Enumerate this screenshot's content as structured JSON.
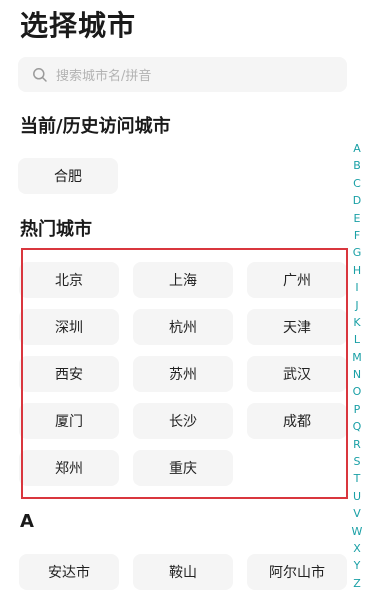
{
  "header": {
    "title": "选择城市"
  },
  "search": {
    "placeholder": "搜索城市名/拼音"
  },
  "current_section": {
    "title": "当前/历史访问城市",
    "cities": [
      "合肥"
    ]
  },
  "hot_section": {
    "title": "热门城市",
    "cities": [
      "北京",
      "上海",
      "广州",
      "深圳",
      "杭州",
      "天津",
      "西安",
      "苏州",
      "武汉",
      "厦门",
      "长沙",
      "成都",
      "郑州",
      "重庆"
    ]
  },
  "letter_section": {
    "title": "A",
    "cities": [
      "安达市",
      "鞍山",
      "阿尔山市"
    ]
  },
  "alpha_index": [
    "A",
    "B",
    "C",
    "D",
    "E",
    "F",
    "G",
    "H",
    "I",
    "J",
    "K",
    "L",
    "M",
    "N",
    "O",
    "P",
    "Q",
    "R",
    "S",
    "T",
    "U",
    "V",
    "W",
    "X",
    "Y",
    "Z"
  ],
  "colors": {
    "accent": "#1aa0a6",
    "highlight": "#d9363e",
    "chip_bg": "#f5f5f5"
  },
  "icons": {
    "search": "search-icon"
  }
}
